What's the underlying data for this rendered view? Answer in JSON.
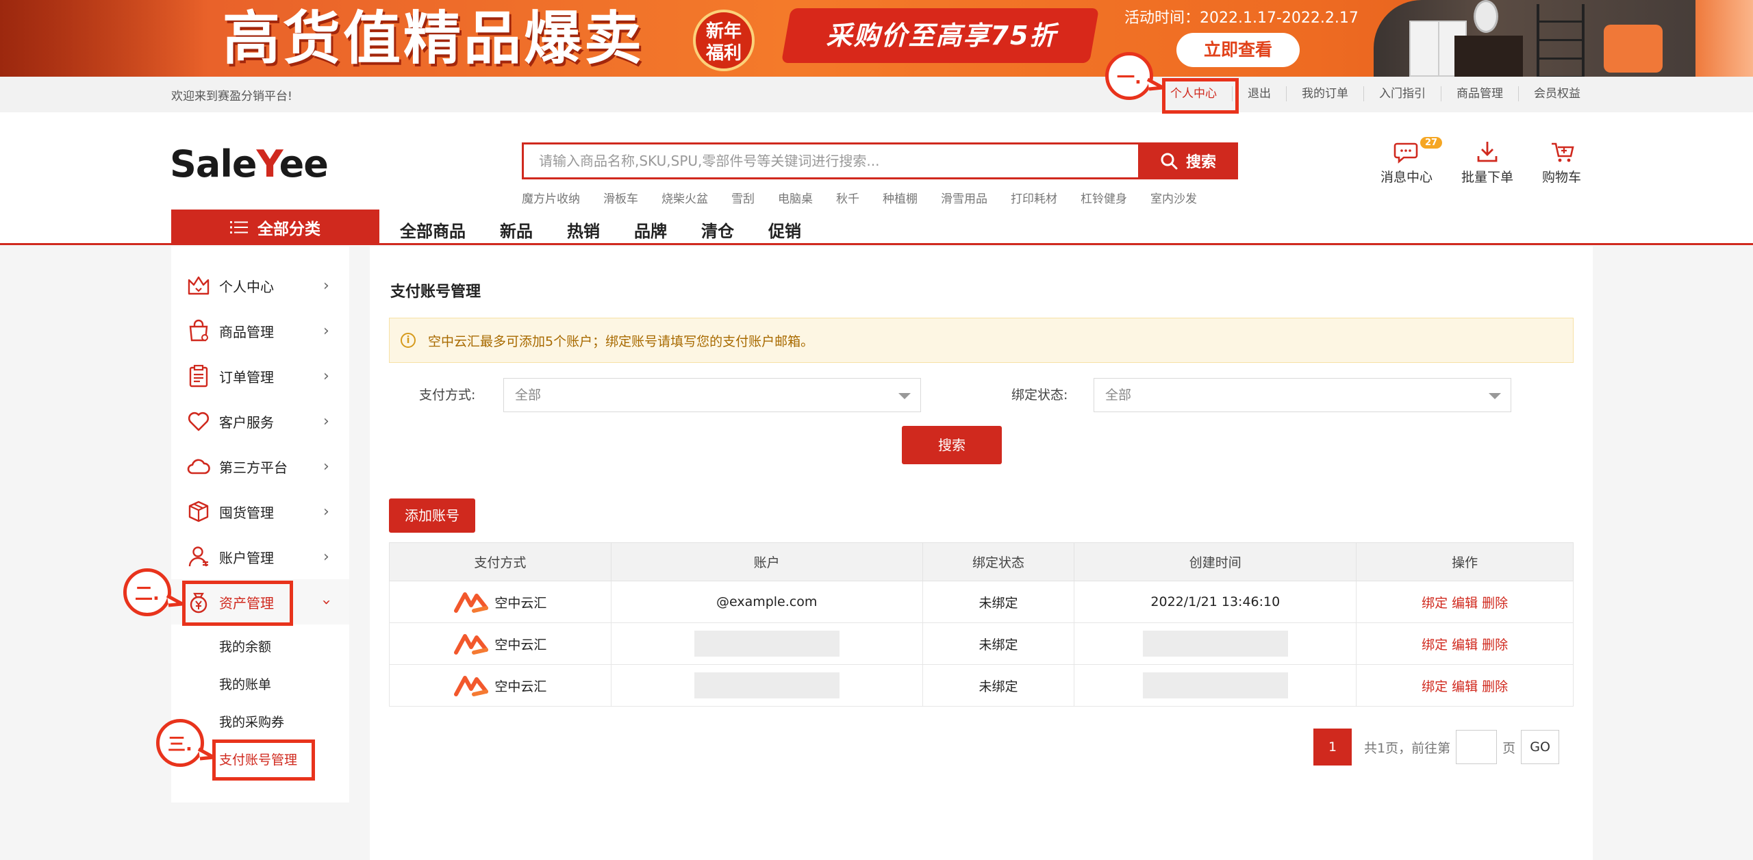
{
  "banner": {
    "headline": "高货值精品爆卖",
    "badge_line1": "新年",
    "badge_line2": "福利",
    "ribbon_text": "采购价至高享75折",
    "period": "活动时间：2022.1.17-2022.2.17",
    "view_button": "立即查看"
  },
  "topbar": {
    "welcome": "欢迎来到赛盈分销平台!",
    "links": [
      "个人中心",
      "退出",
      "我的订单",
      "入门指引",
      "商品管理",
      "会员权益"
    ]
  },
  "header": {
    "logo_pre": "Sale",
    "logo_mid": "Y",
    "logo_post": "ee",
    "search_placeholder": "请输入商品名称,SKU,SPU,零部件号等关键词进行搜索...",
    "search_button": "搜索",
    "hot_words": [
      "魔方片收纳",
      "滑板车",
      "烧柴火盆",
      "雪刮",
      "电脑桌",
      "秋千",
      "种植棚",
      "滑雪用品",
      "打印耗材",
      "杠铃健身",
      "室内沙发"
    ],
    "icons": [
      {
        "label": "消息中心",
        "icon": "message-icon",
        "count": "27"
      },
      {
        "label": "批量下单",
        "icon": "batch-order-icon"
      },
      {
        "label": "购物车",
        "icon": "cart-icon"
      }
    ]
  },
  "catnav": {
    "all_categories": "全部分类",
    "items": [
      "全部商品",
      "新品",
      "热销",
      "品牌",
      "清仓",
      "促销"
    ]
  },
  "sidebar": {
    "items": [
      {
        "label": "个人中心",
        "icon": "crown-icon"
      },
      {
        "label": "商品管理",
        "icon": "shopping-bag-icon"
      },
      {
        "label": "订单管理",
        "icon": "clipboard-icon"
      },
      {
        "label": "客户服务",
        "icon": "heart-icon"
      },
      {
        "label": "第三方平台",
        "icon": "cloud-icon"
      },
      {
        "label": "囤货管理",
        "icon": "box-icon"
      },
      {
        "label": "账户管理",
        "icon": "user-icon"
      },
      {
        "label": "资产管理",
        "icon": "money-bag-icon"
      }
    ],
    "sub_items": [
      "我的余额",
      "我的账单",
      "我的采购券",
      "支付账号管理"
    ]
  },
  "main": {
    "title": "支付账号管理",
    "notice": "空中云汇最多可添加5个账户；绑定账号请填写您的支付账户邮箱。",
    "filter_pay_label": "支付方式:",
    "filter_pay_value": "全部",
    "filter_status_label": "绑定状态:",
    "filter_status_value": "全部",
    "search_button": "搜索",
    "add_button": "添加账号",
    "table": {
      "headers": [
        "支付方式",
        "账户",
        "绑定状态",
        "创建时间",
        "操作"
      ],
      "rows": [
        {
          "pay": "空中云汇",
          "account": "@example.com",
          "status": "未绑定",
          "created": "2022/1/21 13:46:10"
        },
        {
          "pay": "空中云汇",
          "account": "",
          "status": "未绑定",
          "created": ""
        },
        {
          "pay": "空中云汇",
          "account": "",
          "status": "未绑定",
          "created": ""
        }
      ],
      "ops": [
        "绑定",
        "编辑",
        "删除"
      ]
    },
    "pager": {
      "current": "1",
      "summary": "共1页，前往第",
      "suffix": "页",
      "go": "GO"
    }
  },
  "annotations": [
    "一.",
    "二.",
    "三."
  ],
  "colors": {
    "brand_red": "#d0291e",
    "annotation_red": "#e8331c",
    "notice_bg": "#fdf6e3",
    "badge_orange": "#f5a623"
  }
}
